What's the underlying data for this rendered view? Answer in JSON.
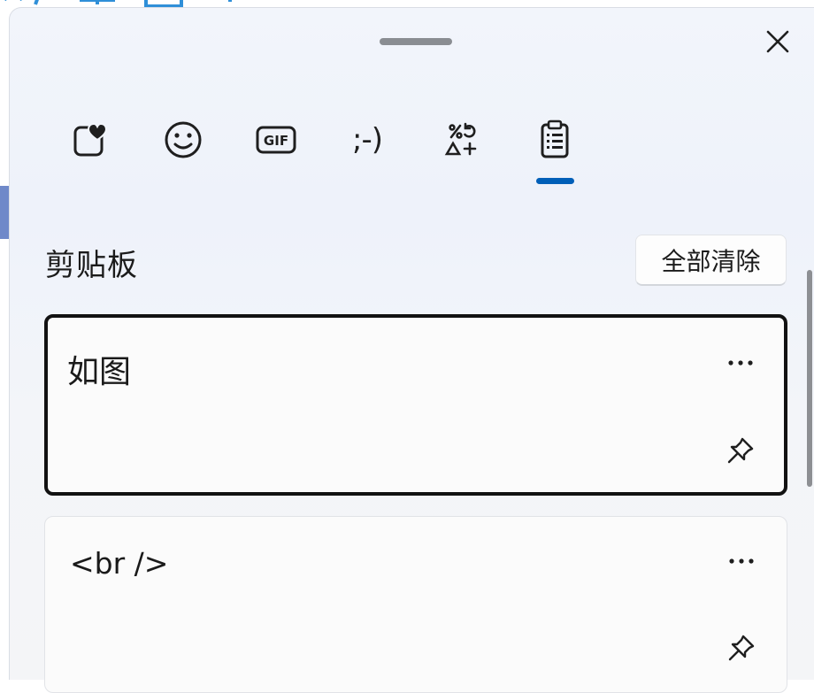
{
  "window": {
    "close_icon": "close-icon",
    "drag_handle": "drag-handle"
  },
  "tabs": [
    {
      "name": "recent",
      "icon": "heart-sticker-icon"
    },
    {
      "name": "emoji",
      "icon": "smiley-icon"
    },
    {
      "name": "gif",
      "icon": "gif-icon",
      "label": "GIF"
    },
    {
      "name": "kaomoji",
      "icon": "kaomoji-icon",
      "label": ";-)"
    },
    {
      "name": "symbols",
      "icon": "symbols-icon"
    },
    {
      "name": "clipboard",
      "icon": "clipboard-icon",
      "selected": true
    }
  ],
  "clipboard": {
    "title": "剪贴板",
    "clear_all_label": "全部清除",
    "items": [
      {
        "text": "如图",
        "selected": true
      },
      {
        "text": "<br />",
        "selected": false
      }
    ]
  },
  "colors": {
    "accent": "#005fb8",
    "selected_border": "#121212",
    "panel_bg": "#f2f5fb"
  }
}
